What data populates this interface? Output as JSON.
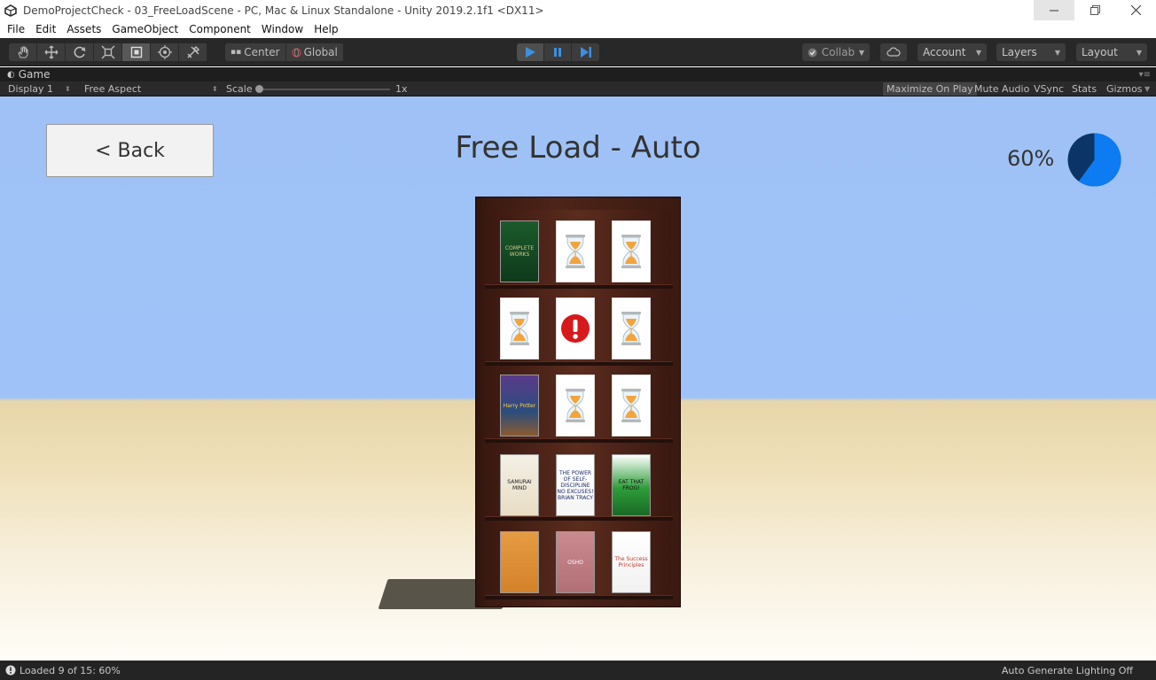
{
  "window": {
    "title": "DemoProjectCheck - 03_FreeLoadScene - PC, Mac & Linux Standalone - Unity 2019.2.1f1 <DX11>",
    "controls": [
      "minimize",
      "maximize",
      "close"
    ]
  },
  "menu": [
    "File",
    "Edit",
    "Assets",
    "GameObject",
    "Component",
    "Window",
    "Help"
  ],
  "toolbar": {
    "tools": [
      "hand-icon",
      "move-icon",
      "rotate-icon",
      "scale-icon",
      "rect-icon",
      "transform-icon",
      "custom-tool-icon"
    ],
    "pivot_label": "Center",
    "space_label": "Global",
    "collab_label": "Collab",
    "account_label": "Account",
    "layers_label": "Layers",
    "layout_label": "Layout"
  },
  "game_tab": {
    "label": "Game",
    "display": "Display 1",
    "aspect": "Free Aspect",
    "scale_label": "Scale",
    "scale_value": "1x",
    "maximize_on_play": "Maximize On Play",
    "mute_audio": "Mute Audio",
    "vsync": "VSync",
    "stats": "Stats",
    "gizmos": "Gizmos"
  },
  "scene": {
    "back_button": "< Back",
    "title": "Free Load - Auto",
    "progress_text": "60%",
    "progress_fraction": 0.6,
    "colors": {
      "pie_remaining": "#0b3566",
      "pie_loaded": "#0d7bf2"
    },
    "shelves": [
      [
        {
          "state": "loaded",
          "cover": "green",
          "text": "COMPLETE WORKS"
        },
        {
          "state": "loading"
        },
        {
          "state": "loading"
        }
      ],
      [
        {
          "state": "loading"
        },
        {
          "state": "error"
        },
        {
          "state": "loading"
        }
      ],
      [
        {
          "state": "loaded",
          "cover": "harry",
          "text": "Harry Potter"
        },
        {
          "state": "loading"
        },
        {
          "state": "loading"
        }
      ],
      [
        {
          "state": "loaded",
          "cover": "samurai",
          "text": "SAMURAI MIND"
        },
        {
          "state": "loaded",
          "cover": "excuses",
          "text": "THE POWER OF SELF-DISCIPLINE NO EXCUSES! BRIAN TRACY"
        },
        {
          "state": "loaded",
          "cover": "frog",
          "text": "EAT THAT FROG!"
        }
      ],
      [
        {
          "state": "loaded",
          "cover": "orange",
          "text": ""
        },
        {
          "state": "loaded",
          "cover": "osho",
          "text": "OSHO"
        },
        {
          "state": "loaded",
          "cover": "success",
          "text": "The Success Principles"
        }
      ]
    ]
  },
  "status": {
    "message": "Loaded 9 of 15: 60%",
    "right": "Auto Generate Lighting Off"
  }
}
